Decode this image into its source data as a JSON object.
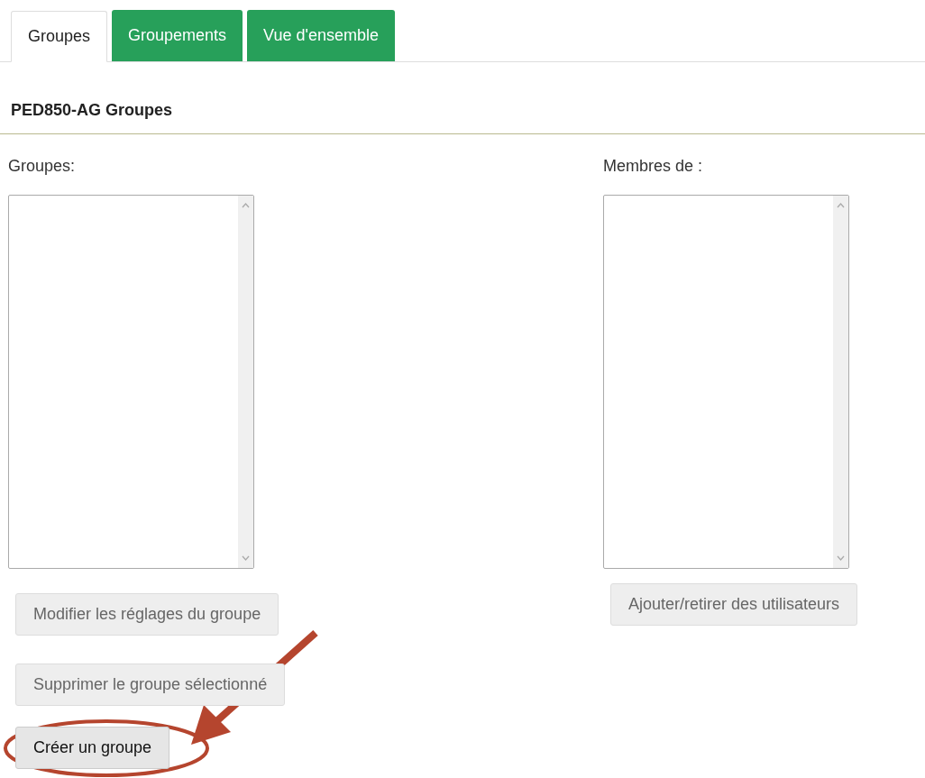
{
  "tabs": [
    {
      "label": "Groupes",
      "selected": true
    },
    {
      "label": "Groupements",
      "selected": false
    },
    {
      "label": "Vue d'ensemble",
      "selected": false
    }
  ],
  "heading": "PED850-AG Groupes",
  "groups_panel": {
    "label": "Groupes:",
    "buttons": [
      {
        "label": "Modifier les réglages du groupe",
        "disabled": true
      },
      {
        "label": "Supprimer le groupe sélectionné",
        "disabled": true
      },
      {
        "label": "Créer un groupe",
        "disabled": false
      }
    ]
  },
  "members_panel": {
    "label": "Membres de :",
    "buttons": [
      {
        "label": "Ajouter/retirer des utilisateurs",
        "disabled": true
      }
    ]
  }
}
